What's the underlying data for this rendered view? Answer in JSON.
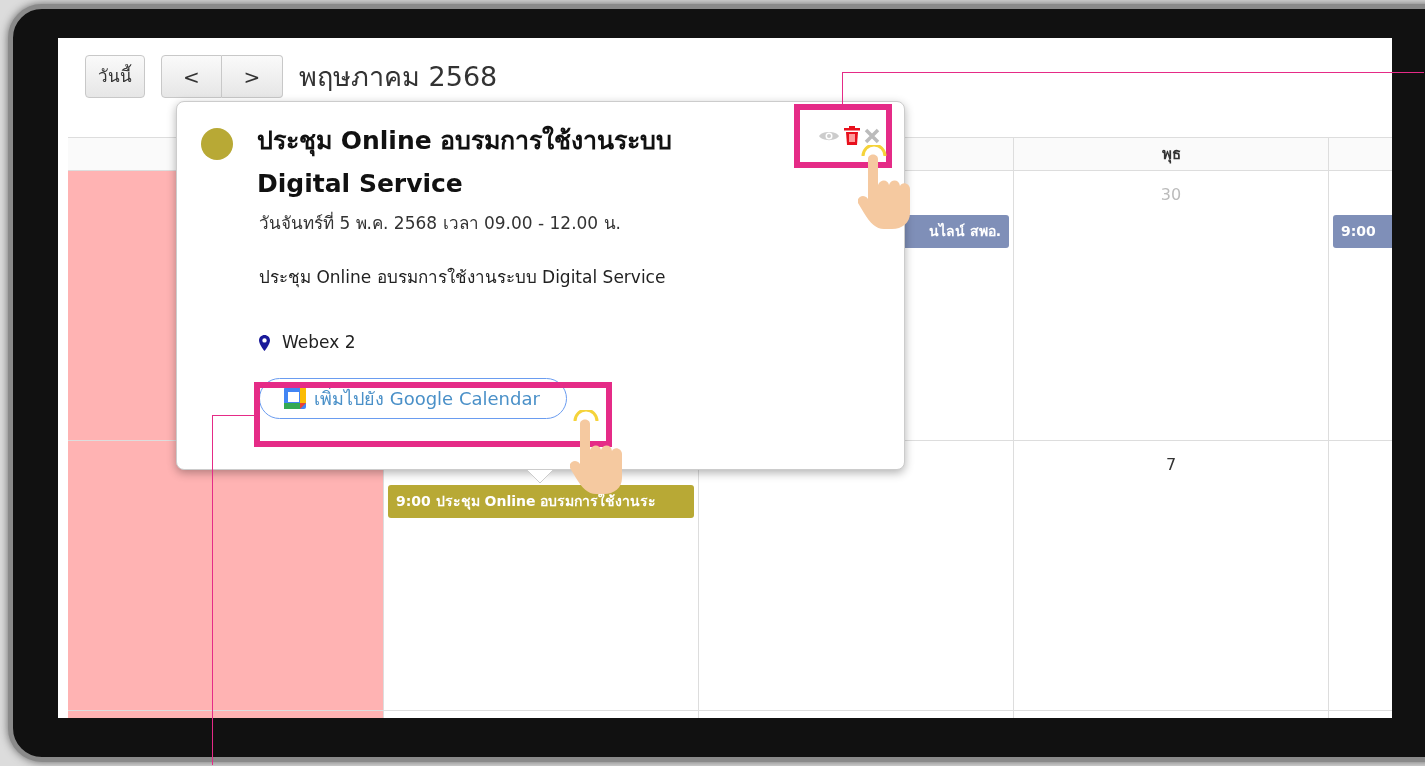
{
  "toolbar": {
    "today_button": "วันนี้",
    "prev_button": "<",
    "next_button": ">",
    "title": "พฤษภาคม 2568"
  },
  "calendar": {
    "headers": [
      {
        "label": "พุธ"
      }
    ],
    "weeks": [
      {
        "cells": [
          {
            "highlighted": true
          },
          {},
          {
            "highlighted": false,
            "events": [
              {
                "text": "นไลน์ สพอ.",
                "color": "#7f8fb8"
              }
            ]
          },
          {
            "highlighted": false,
            "day": "30",
            "other_month": true
          },
          {
            "highlighted": false,
            "events": [
              {
                "text": "9:00",
                "color": "#7f8fb8"
              }
            ]
          }
        ]
      },
      {
        "cells": [
          {
            "highlighted": true
          },
          {
            "highlighted": false,
            "events": [
              {
                "text": "9:00 ประชุม Online อบรมการใช้งานระ",
                "color": "#b8a935"
              }
            ]
          },
          {
            "highlighted": false
          },
          {
            "highlighted": false,
            "day": "7",
            "other_month": false
          },
          {
            "highlighted": false
          }
        ]
      },
      {
        "cells": [
          {
            "highlighted": true
          },
          {},
          {},
          {},
          {}
        ]
      }
    ]
  },
  "popover": {
    "color": "#b8a935",
    "title": "ประชุม Online อบรมการใช้งานระบบ Digital Service",
    "date": "วันจันทร์ที่ 5 พ.ค. 2568 เวลา 09.00 - 12.00 น.",
    "description": "ประชุม Online อบรมการใช้งานระบบ Digital Service",
    "location": "Webex 2",
    "google_button": "เพิ่มไปยัง Google Calendar"
  }
}
